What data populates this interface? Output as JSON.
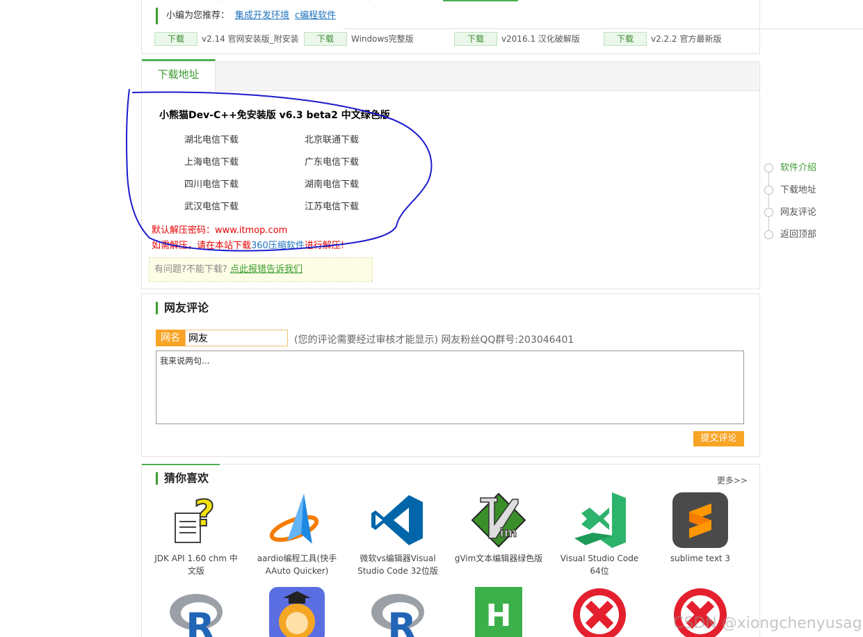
{
  "top": {
    "recommend_label": "小编为您推荐：",
    "links": [
      "集成开发环境",
      "c编程软件"
    ],
    "downloads": [
      {
        "button": "下载",
        "text": "v2.14 官网安装版_附安装"
      },
      {
        "button": "下载",
        "text": "Windows完整版"
      },
      {
        "button": "下载",
        "text": "v2016.1 汉化破解版"
      },
      {
        "button": "下载",
        "text": "v2.2.2 官方最新版"
      }
    ]
  },
  "download": {
    "tab": "下载地址",
    "title": "小熊猫Dev-C++免安装版 v6.3 beta2 中文绿色版",
    "mirrors": [
      "湖北电信下载",
      "北京联通下载",
      "上海电信下载",
      "广东电信下载",
      "四川电信下载",
      "湖南电信下载",
      "武汉电信下载",
      "江苏电信下载"
    ],
    "password": "默认解压密码：www.itmop.com",
    "unzip_pre": "如需解压，请在本站下载",
    "unzip_link": "360压缩软件",
    "unzip_post": "进行解压!",
    "report_pre": "有问题?不能下载?",
    "report_link": "点此报错告诉我们"
  },
  "sidenav": [
    "软件介绍",
    "下载地址",
    "网友评论",
    "返回顶部"
  ],
  "comments": {
    "title": "网友评论",
    "name_label": "网名",
    "name_value": "网友",
    "hint": "(您的评论需要经过审核才能显示) 网友粉丝QQ群号:203046401",
    "textarea": "我来说两句...",
    "submit": "提交评论"
  },
  "recommend": {
    "title": "猜你喜欢",
    "more": "更多>>",
    "apps": [
      {
        "name": "JDK API 1.60 chm 中文版",
        "icon": "help-doc-icon"
      },
      {
        "name": "aardio编程工具(快手AAuto Quicker)",
        "icon": "aardio-icon"
      },
      {
        "name": "微软vs编辑器Visual Studio Code 32位版",
        "icon": "vscode-icon"
      },
      {
        "name": "gVim文本编辑器绿色版",
        "icon": "vim-icon"
      },
      {
        "name": "Visual Studio Code 64位",
        "icon": "vscode-green-icon"
      },
      {
        "name": "sublime text 3",
        "icon": "sublime-icon"
      }
    ],
    "row2_icons": [
      "r-icon",
      "lion-icon",
      "r-icon",
      "hbuilder-icon",
      "x-icon",
      "x-icon"
    ]
  },
  "watermark": "CSDN @xiongchenyusage"
}
